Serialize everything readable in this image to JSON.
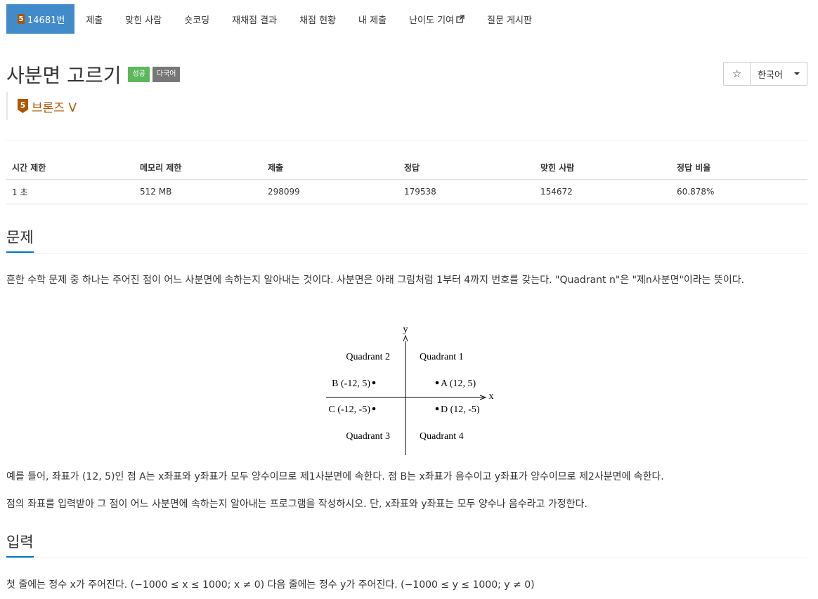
{
  "nav": {
    "problem_tab": {
      "tier_number": "5",
      "label": "14681번"
    },
    "items": [
      "제출",
      "맞힌 사람",
      "숏코딩",
      "재채점 결과",
      "채점 현황",
      "내 제출",
      "난이도 기여",
      "질문 게시판"
    ]
  },
  "problem": {
    "title": "사분면 고르기",
    "badges": {
      "status": "성공",
      "language": "다국어"
    },
    "tier": {
      "number": "5",
      "label": "브론즈 V",
      "color": "#ad5600"
    }
  },
  "toolbar": {
    "star_icon": "star-outline-icon",
    "language": "한국어"
  },
  "stats": {
    "headers": [
      "시간 제한",
      "메모리 제한",
      "제출",
      "정답",
      "맞힌 사람",
      "정답 비율"
    ],
    "values": [
      "1 초",
      "512 MB",
      "298099",
      "179538",
      "154672",
      "60.878%"
    ]
  },
  "sections": {
    "problem": {
      "heading": "문제",
      "description": "흔한 수학 문제 중 하나는 주어진 점이 어느 사분면에 속하는지 알아내는 것이다. 사분면은 아래 그림처럼 1부터 4까지 번호를 갖는다. \"Quadrant n\"은 \"제n사분면\"이라는 뜻이다.",
      "example": "예를 들어, 좌표가 (12, 5)인 점 A는 x좌표와 y좌표가 모두 양수이므로 제1사분면에 속한다. 점 B는 x좌표가 음수이고 y좌표가 양수이므로 제2사분면에 속한다.",
      "task": "점의 좌표를 입력받아 그 점이 어느 사분면에 속하는지 알아내는 프로그램을 작성하시오. 단, x좌표와 y좌표는 모두 양수나 음수라고 가정한다."
    },
    "input": {
      "heading": "입력",
      "description": "첫 줄에는 정수 x가 주어진다. (−1000 ≤ x ≤ 1000; x ≠ 0) 다음 줄에는 정수 y가 주어진다. (−1000 ≤ y ≤ 1000; y ≠ 0)"
    }
  },
  "figure": {
    "axis_x": "x",
    "axis_y": "y",
    "quadrants": [
      "Quadrant 1",
      "Quadrant 2",
      "Quadrant 3",
      "Quadrant 4"
    ],
    "points": [
      "A (12, 5)",
      "B (-12, 5)",
      "C (-12, -5)",
      "D (12, -5)"
    ]
  },
  "colors": {
    "active_tab": "#428bca",
    "success": "#5cb85c",
    "language_badge": "#777777",
    "bronze": "#ad5600",
    "section_underline": "#0076c0"
  }
}
